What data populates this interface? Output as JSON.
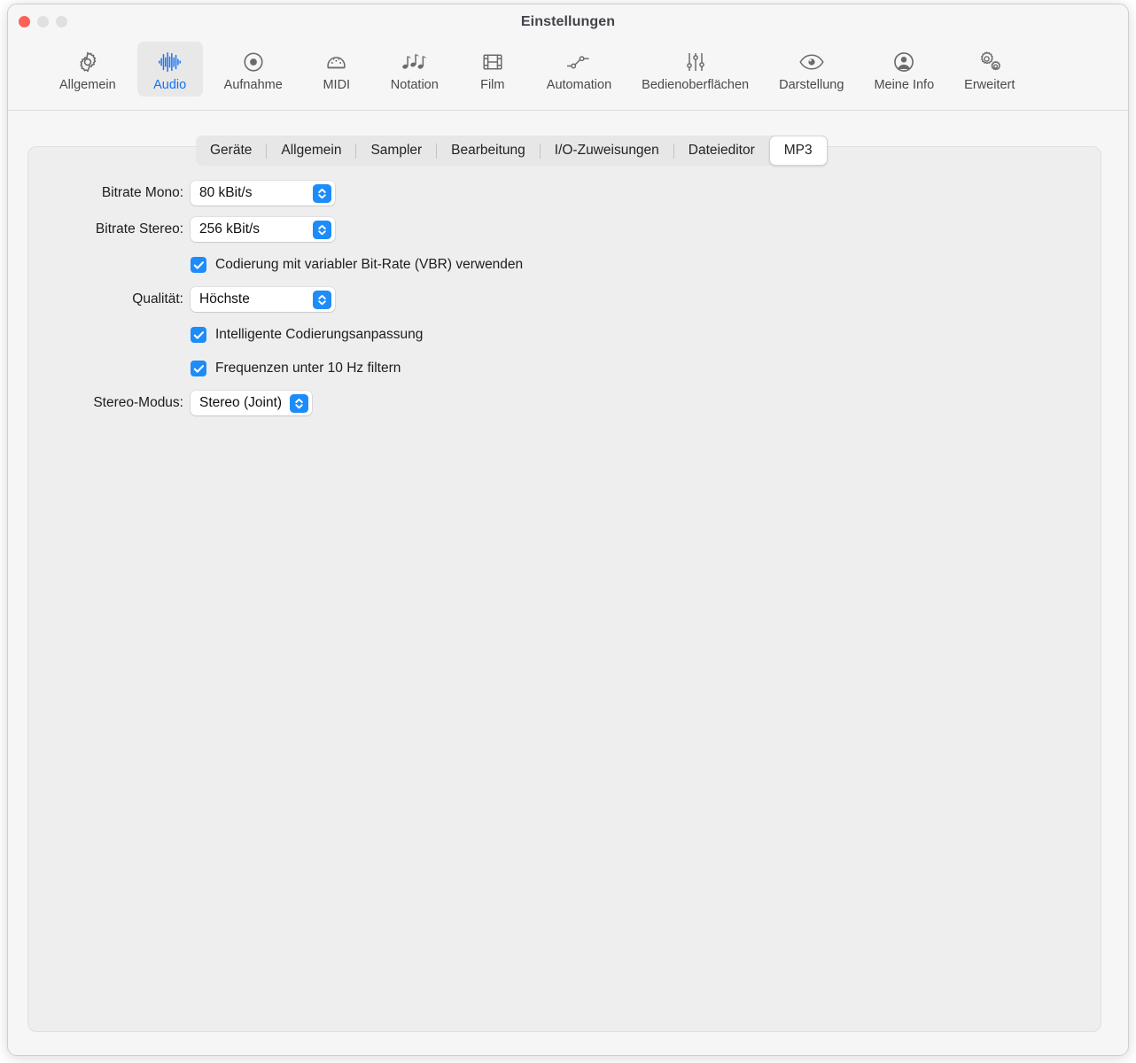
{
  "window": {
    "title": "Einstellungen",
    "traffic_lights": {
      "close": "close-button",
      "minimize": "minimize-button",
      "zoom": "zoom-button"
    }
  },
  "toolbar": {
    "items": [
      {
        "label": "Allgemein",
        "icon": "gear-icon",
        "selected": false
      },
      {
        "label": "Audio",
        "icon": "audio-waveform-icon",
        "selected": true
      },
      {
        "label": "Aufnahme",
        "icon": "record-circle-icon",
        "selected": false
      },
      {
        "label": "MIDI",
        "icon": "midi-connector-icon",
        "selected": false
      },
      {
        "label": "Notation",
        "icon": "music-notes-icon",
        "selected": false
      },
      {
        "label": "Film",
        "icon": "film-strip-icon",
        "selected": false
      },
      {
        "label": "Automation",
        "icon": "automation-curve-icon",
        "selected": false
      },
      {
        "label": "Bedienoberflächen",
        "icon": "sliders-icon",
        "selected": false
      },
      {
        "label": "Darstellung",
        "icon": "eye-icon",
        "selected": false
      },
      {
        "label": "Meine Info",
        "icon": "person-circle-icon",
        "selected": false
      },
      {
        "label": "Erweitert",
        "icon": "double-gear-icon",
        "selected": false
      }
    ],
    "accent_color": "#1273f1"
  },
  "tabs": [
    {
      "label": "Geräte",
      "selected": false
    },
    {
      "label": "Allgemein",
      "selected": false
    },
    {
      "label": "Sampler",
      "selected": false
    },
    {
      "label": "Bearbeitung",
      "selected": false
    },
    {
      "label": "I/O-Zuweisungen",
      "selected": false
    },
    {
      "label": "Dateieditor",
      "selected": false
    },
    {
      "label": "MP3",
      "selected": true
    }
  ],
  "settings": {
    "bitrate_mono": {
      "label": "Bitrate Mono:",
      "value": "80 kBit/s"
    },
    "bitrate_stereo": {
      "label": "Bitrate Stereo:",
      "value": "256 kBit/s"
    },
    "vbr": {
      "label": "Codierung mit variabler Bit-Rate (VBR) verwenden",
      "checked": true
    },
    "quality": {
      "label": "Qualität:",
      "value": "Höchste"
    },
    "smart_encoding": {
      "label": "Intelligente Codierungsanpassung",
      "checked": true
    },
    "filter_frequencies": {
      "label": "Frequenzen unter 10 Hz filtern",
      "checked": true
    },
    "stereo_mode": {
      "label": "Stereo-Modus:",
      "value": "Stereo (Joint)"
    }
  },
  "colors": {
    "accent_blue": "#1e8cf8",
    "close_red": "#fc6058",
    "panel_bg": "#eeeeee",
    "window_bg": "#f6f6f6"
  }
}
